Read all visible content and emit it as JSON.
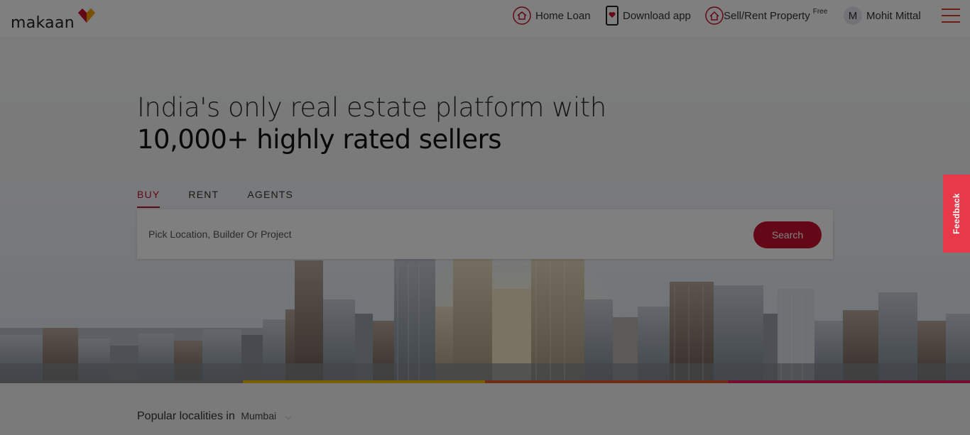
{
  "brand": {
    "logo_text": "makaan"
  },
  "header": {
    "home_loan": "Home Loan",
    "download_app": "Download app",
    "sell_rent": "Sell/Rent Property",
    "sell_rent_badge": "Free",
    "user_initial": "M",
    "user_name": "Mohit Mittal"
  },
  "hero": {
    "headline_line1": "India's only real estate platform with",
    "headline_line2": "10,000+ highly rated sellers"
  },
  "tabs": [
    {
      "label": "BUY",
      "active": true
    },
    {
      "label": "RENT",
      "active": false
    },
    {
      "label": "AGENTS",
      "active": false
    }
  ],
  "search": {
    "placeholder": "Pick Location, Builder Or Project",
    "button_label": "Search"
  },
  "feedback": {
    "label": "Feedback"
  },
  "popular": {
    "label": "Popular localities in",
    "city": "Mumbai"
  },
  "colors": {
    "brand_red": "#c8102e",
    "feedback_red": "#e8394a",
    "colorbar": [
      "#8a8a8a",
      "#f4c300",
      "#e65a24",
      "#e8195e"
    ]
  },
  "icons": {
    "home_loan": "home-loan-icon",
    "download_app": "mobile-phone-icon",
    "sell_rent": "house-icon",
    "menu": "hamburger-menu-icon",
    "dropdown": "chevron-down-icon"
  }
}
